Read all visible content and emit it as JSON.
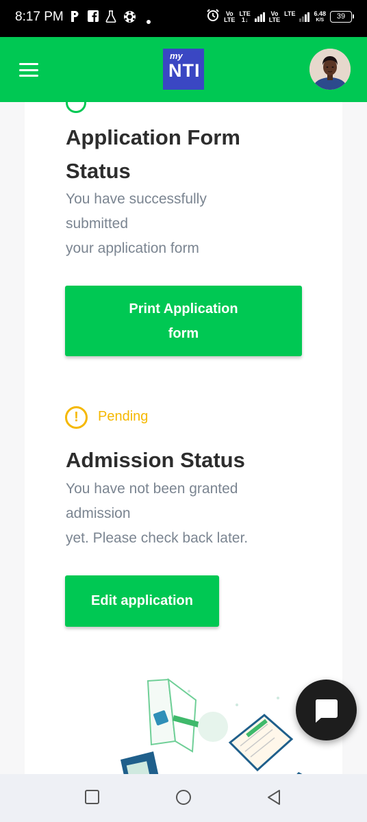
{
  "status_bar": {
    "time": "8:17 PM",
    "net1_top": "Vo",
    "net1_bottom": "LTE",
    "net2_top": "LTE",
    "net2_bottom": "1↓",
    "net3_top": "Vo",
    "net3_bottom": "LTE",
    "net4_top": "LTE",
    "speed_value": "6.48",
    "speed_unit": "K/S",
    "battery": "39"
  },
  "header": {
    "logo_small": "my",
    "logo_main": "NTI",
    "brand_color": "#00c853"
  },
  "application_section": {
    "title_line1": "Application Form",
    "title_line2": "Status",
    "desc_line1": "You have successfully",
    "desc_line2": "submitted",
    "desc_line3": "your application form",
    "button_line1": "Print Application",
    "button_line2": "form"
  },
  "admission_section": {
    "status_label": "Pending",
    "status_icon": "!",
    "status_color": "#f5b800",
    "title": "Admission Status",
    "desc_line1": "You have not been granted",
    "desc_line2": "admission",
    "desc_line3": "yet. Please check back later.",
    "button_label": "Edit application"
  }
}
